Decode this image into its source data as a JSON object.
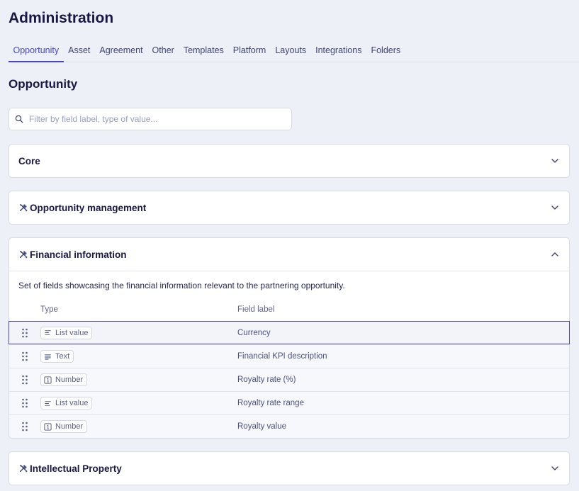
{
  "header": {
    "title": "Administration"
  },
  "tabs": [
    {
      "label": "Opportunity",
      "active": true
    },
    {
      "label": "Asset"
    },
    {
      "label": "Agreement"
    },
    {
      "label": "Other"
    },
    {
      "label": "Templates"
    },
    {
      "label": "Platform"
    },
    {
      "label": "Layouts"
    },
    {
      "label": "Integrations"
    },
    {
      "label": "Folders"
    }
  ],
  "section": {
    "title": "Opportunity"
  },
  "search": {
    "placeholder": "Filter by field label, type of value...",
    "value": ""
  },
  "groups": {
    "core": {
      "title": "Core",
      "expanded": false,
      "icon": "chevron-down-icon"
    },
    "opportunity_management": {
      "title": "Opportunity management",
      "expanded": false,
      "icon": "tools-icon"
    },
    "financial_information": {
      "title": "Financial information",
      "expanded": true,
      "icon": "tools-icon",
      "description": "Set of fields showcasing the financial information relevant to the partnering opportunity.",
      "columns": {
        "type": "Type",
        "field_label": "Field label"
      },
      "rows": [
        {
          "type": "List value",
          "type_icon": "list-icon",
          "label": "Currency",
          "selected": true
        },
        {
          "type": "Text",
          "type_icon": "text-icon",
          "label": "Financial KPI description"
        },
        {
          "type": "Number",
          "type_icon": "number-icon",
          "label": "Royalty rate (%)"
        },
        {
          "type": "List value",
          "type_icon": "list-icon",
          "label": "Royalty rate range"
        },
        {
          "type": "Number",
          "type_icon": "number-icon",
          "label": "Royalty value"
        }
      ]
    },
    "intellectual_property": {
      "title": "Intellectual Property",
      "expanded": false,
      "icon": "tools-icon"
    }
  },
  "colors": {
    "accent": "#4a45c7",
    "background": "#eef0f8",
    "title": "#1a1744"
  }
}
